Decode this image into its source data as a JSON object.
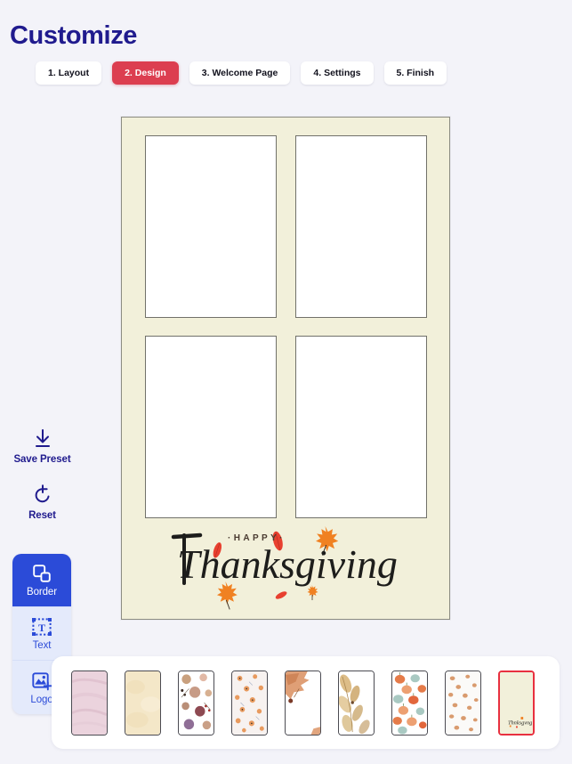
{
  "header": {
    "title": "Customize"
  },
  "steps": [
    {
      "label": "1. Layout",
      "active": false
    },
    {
      "label": "2. Design",
      "active": true
    },
    {
      "label": "3. Welcome Page",
      "active": false
    },
    {
      "label": "4. Settings",
      "active": false
    },
    {
      "label": "5. Finish",
      "active": false
    }
  ],
  "rail": {
    "actions": [
      {
        "label": "Save Preset",
        "icon": "download-icon"
      },
      {
        "label": "Reset",
        "icon": "undo-icon"
      }
    ],
    "tools": [
      {
        "label": "Border",
        "icon": "border-shapes-icon",
        "active": true
      },
      {
        "label": "Text",
        "icon": "text-box-icon",
        "active": false
      },
      {
        "label": "Logo",
        "icon": "add-image-icon",
        "active": false
      }
    ]
  },
  "canvas": {
    "background_color": "#F2F0DA",
    "border_color": "#8C8C82",
    "slot_fill": "#FFFFFF",
    "slot_border": "#71716A",
    "slots": [
      {
        "name": "photo-slot-1"
      },
      {
        "name": "photo-slot-2"
      },
      {
        "name": "photo-slot-3"
      },
      {
        "name": "photo-slot-4"
      }
    ],
    "artwork": {
      "script_text": "Thanksgiving",
      "small_text": "·H A P P Y·",
      "script_color": "#1D1D1B",
      "small_text_color": "#4A3B31",
      "leaf_orange": "#F08122",
      "leaf_red": "#E8402F"
    }
  },
  "templates": {
    "selected_index": 8,
    "items": [
      {
        "name": "pink-marble",
        "kind": "solid",
        "base": "#EBD3DD"
      },
      {
        "name": "cream-parchment",
        "kind": "solid",
        "base": "#F4E7C8"
      },
      {
        "name": "dried-florals",
        "kind": "scatter",
        "base": "#FFFFFF"
      },
      {
        "name": "small-orange-flowers",
        "kind": "scatter",
        "base": "#F7F2F0"
      },
      {
        "name": "oak-leaf-corner",
        "kind": "corner",
        "base": "#FFFFFF"
      },
      {
        "name": "golden-foliage",
        "kind": "corner",
        "base": "#FFFFFF"
      },
      {
        "name": "pumpkin-pattern",
        "kind": "pumpkins",
        "base": "#FFFFFF"
      },
      {
        "name": "tiny-pumpkins",
        "kind": "scatter",
        "base": "#FBFAF8"
      },
      {
        "name": "thanksgiving-cream",
        "kind": "selected",
        "base": "#F2F0DA"
      }
    ]
  },
  "colors": {
    "page_background": "#F3F3F9",
    "title_blue": "#201B8E",
    "accent_red": "#DC3E50",
    "tool_blue": "#2B4BD8",
    "tool_blue_light": "#E4EAFB",
    "selected_thumb_border": "#E8303F"
  }
}
